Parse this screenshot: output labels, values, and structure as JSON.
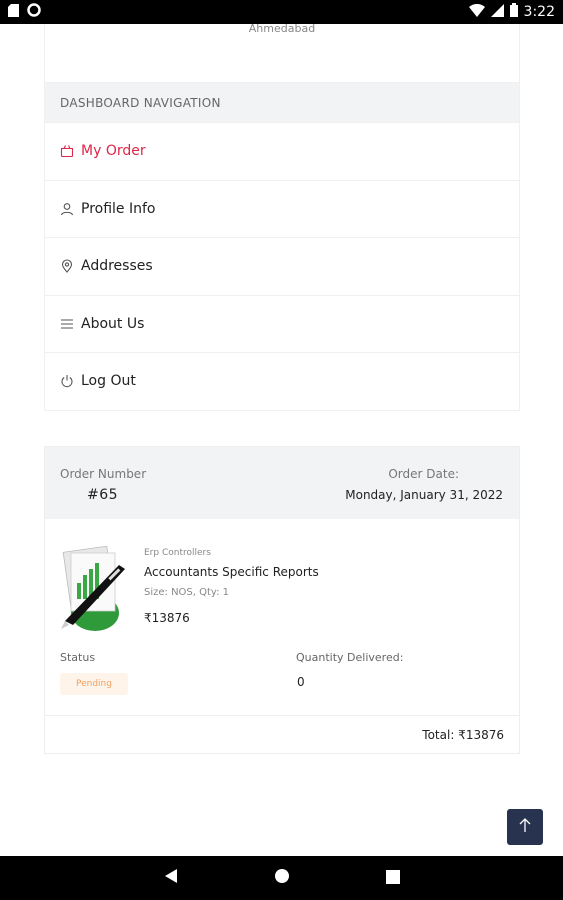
{
  "status_bar": {
    "time": "3:22",
    "icons": [
      "sd-card-icon",
      "circle-icon",
      "wifi-icon",
      "signal-icon",
      "battery-icon"
    ]
  },
  "top_card": {
    "city": "Ahmedabad"
  },
  "dashboard": {
    "header": "DASHBOARD NAVIGATION",
    "items": [
      {
        "label": "My Order",
        "icon": "basket-icon",
        "active": true
      },
      {
        "label": "Profile Info",
        "icon": "user-icon",
        "active": false
      },
      {
        "label": "Addresses",
        "icon": "location-pin-icon",
        "active": false
      },
      {
        "label": "About Us",
        "icon": "menu-lines-icon",
        "active": false
      },
      {
        "label": "Log Out",
        "icon": "power-icon",
        "active": false
      }
    ],
    "active_color": "#e0264a"
  },
  "order": {
    "number_label": "Order Number",
    "number": "#65",
    "date_label": "Order Date:",
    "date": "Monday, January 31, 2022",
    "product": {
      "vendor": "Erp Controllers",
      "name": "Accountants Specific Reports",
      "size_qty": "Size: NOS, Qty: 1",
      "price": "₹13876"
    },
    "status_label": "Status",
    "status": "Pending",
    "qty_delivered_label": "Quantity Delivered:",
    "qty_delivered": "0",
    "total": "Total: ₹13876"
  },
  "colors": {
    "accent": "#e0264a",
    "pending": "#f0a060",
    "scroll_button": "#28334f"
  }
}
